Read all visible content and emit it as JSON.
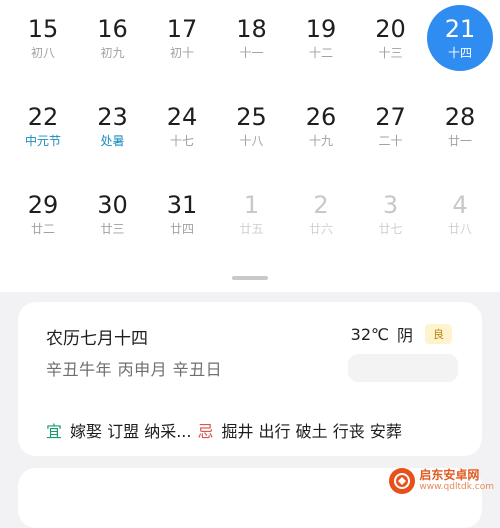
{
  "calendar": {
    "weeks": [
      [
        {
          "num": "15",
          "lunar": "初八",
          "type": "normal"
        },
        {
          "num": "16",
          "lunar": "初九",
          "type": "normal"
        },
        {
          "num": "17",
          "lunar": "初十",
          "type": "normal"
        },
        {
          "num": "18",
          "lunar": "十一",
          "type": "normal"
        },
        {
          "num": "19",
          "lunar": "十二",
          "type": "normal"
        },
        {
          "num": "20",
          "lunar": "十三",
          "type": "normal"
        },
        {
          "num": "21",
          "lunar": "十四",
          "type": "selected"
        }
      ],
      [
        {
          "num": "22",
          "lunar": "中元节",
          "type": "festival"
        },
        {
          "num": "23",
          "lunar": "处暑",
          "type": "festival"
        },
        {
          "num": "24",
          "lunar": "十七",
          "type": "normal"
        },
        {
          "num": "25",
          "lunar": "十八",
          "type": "normal"
        },
        {
          "num": "26",
          "lunar": "十九",
          "type": "normal"
        },
        {
          "num": "27",
          "lunar": "二十",
          "type": "normal"
        },
        {
          "num": "28",
          "lunar": "廿一",
          "type": "normal"
        }
      ],
      [
        {
          "num": "29",
          "lunar": "廿二",
          "type": "normal"
        },
        {
          "num": "30",
          "lunar": "廿三",
          "type": "normal"
        },
        {
          "num": "31",
          "lunar": "廿四",
          "type": "normal"
        },
        {
          "num": "1",
          "lunar": "廿五",
          "type": "other"
        },
        {
          "num": "2",
          "lunar": "廿六",
          "type": "other"
        },
        {
          "num": "3",
          "lunar": "廿七",
          "type": "other"
        },
        {
          "num": "4",
          "lunar": "廿八",
          "type": "other"
        }
      ]
    ]
  },
  "info": {
    "lunar_date": "农历七月十四",
    "ganzhi": "辛丑牛年 丙申月 辛丑日",
    "temperature": "32℃",
    "condition": "阴",
    "aqi": "良",
    "yi_label": "宜",
    "yi_items": "嫁娶 订盟 纳采...",
    "ji_label": "忌",
    "ji_items": "掘井 出行 破土 行丧 安葬"
  },
  "watermark": {
    "title": "启东安卓网",
    "url": "www.qdltdk.com"
  },
  "colors": {
    "selected": "#2f8cf0",
    "festival": "#1b8cc0",
    "yi": "#1b9c6a",
    "ji": "#d9544f"
  }
}
